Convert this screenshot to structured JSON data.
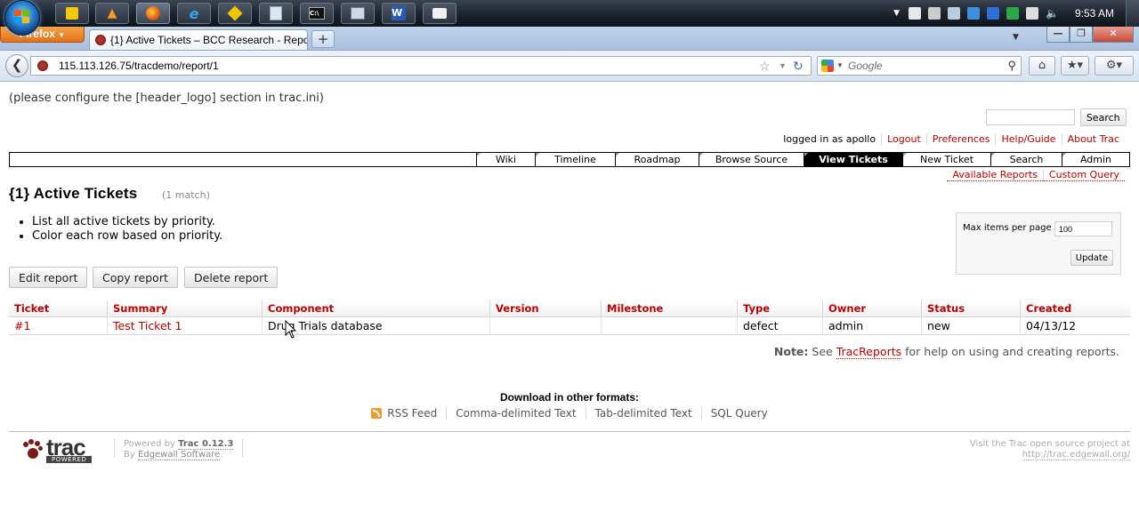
{
  "taskbar": {
    "clock": "9:53 AM",
    "pinned": [
      "outlook-icon",
      "flame-icon",
      "firefox-icon",
      "ie-icon",
      "app-icon",
      "docs-icon",
      "cmd-icon",
      "window-icon",
      "word-icon",
      "folder-icon"
    ]
  },
  "browser": {
    "menu_button": "Firefox",
    "tab_title": "{1} Active Tickets – BCC Research - Repo...",
    "url": "115.113.126.75/tracdemo/report/1",
    "search_placeholder": "Google"
  },
  "trac": {
    "header_logo_msg": "(please configure the [header_logo] section in trac.ini)",
    "search_button": "Search",
    "metanav": {
      "logged_in": "logged in as apollo",
      "links": [
        "Logout",
        "Preferences",
        "Help/Guide",
        "About Trac"
      ]
    },
    "mainnav": [
      "Wiki",
      "Timeline",
      "Roadmap",
      "Browse Source",
      "View Tickets",
      "New Ticket",
      "Search",
      "Admin"
    ],
    "mainnav_active": "View Tickets",
    "ctxtnav": [
      "Available Reports",
      "Custom Query"
    ],
    "report_title": "{1} Active Tickets",
    "num_rows": "(1 match)",
    "description": [
      "List all active tickets by priority.",
      "Color each row based on priority."
    ],
    "prefs": {
      "label": "Max items per page",
      "value": "100",
      "button": "Update"
    },
    "buttons": {
      "edit": "Edit report",
      "copy": "Copy report",
      "delete": "Delete report"
    },
    "table": {
      "columns": [
        "Ticket",
        "Summary",
        "Component",
        "Version",
        "Milestone",
        "Type",
        "Owner",
        "Status",
        "Created"
      ],
      "rows": [
        {
          "ticket": "#1",
          "summary": "Test Ticket 1",
          "component": "Drug Trials database",
          "version": "",
          "milestone": "",
          "type": "defect",
          "owner": "admin",
          "status": "new",
          "created": "04/13/12"
        }
      ]
    },
    "note": {
      "label": "Note:",
      "pre": "See",
      "link": "TracReports",
      "post": "for help on using and creating reports."
    },
    "altlinks": {
      "heading": "Download in other formats:",
      "items": [
        "RSS Feed",
        "Comma-delimited Text",
        "Tab-delimited Text",
        "SQL Query"
      ]
    },
    "footer": {
      "logo_text": "trac",
      "logo_sub": "POWERED",
      "powered_by": "Powered by",
      "trac_version": "Trac 0.12.3",
      "by": "By",
      "edgewall": "Edgewall Software",
      "visit": "Visit the Trac open source project at",
      "site_url": "http://trac.edgewall.org/"
    }
  },
  "colors": {
    "link": "#bb0000",
    "active_nav": "#000000"
  }
}
